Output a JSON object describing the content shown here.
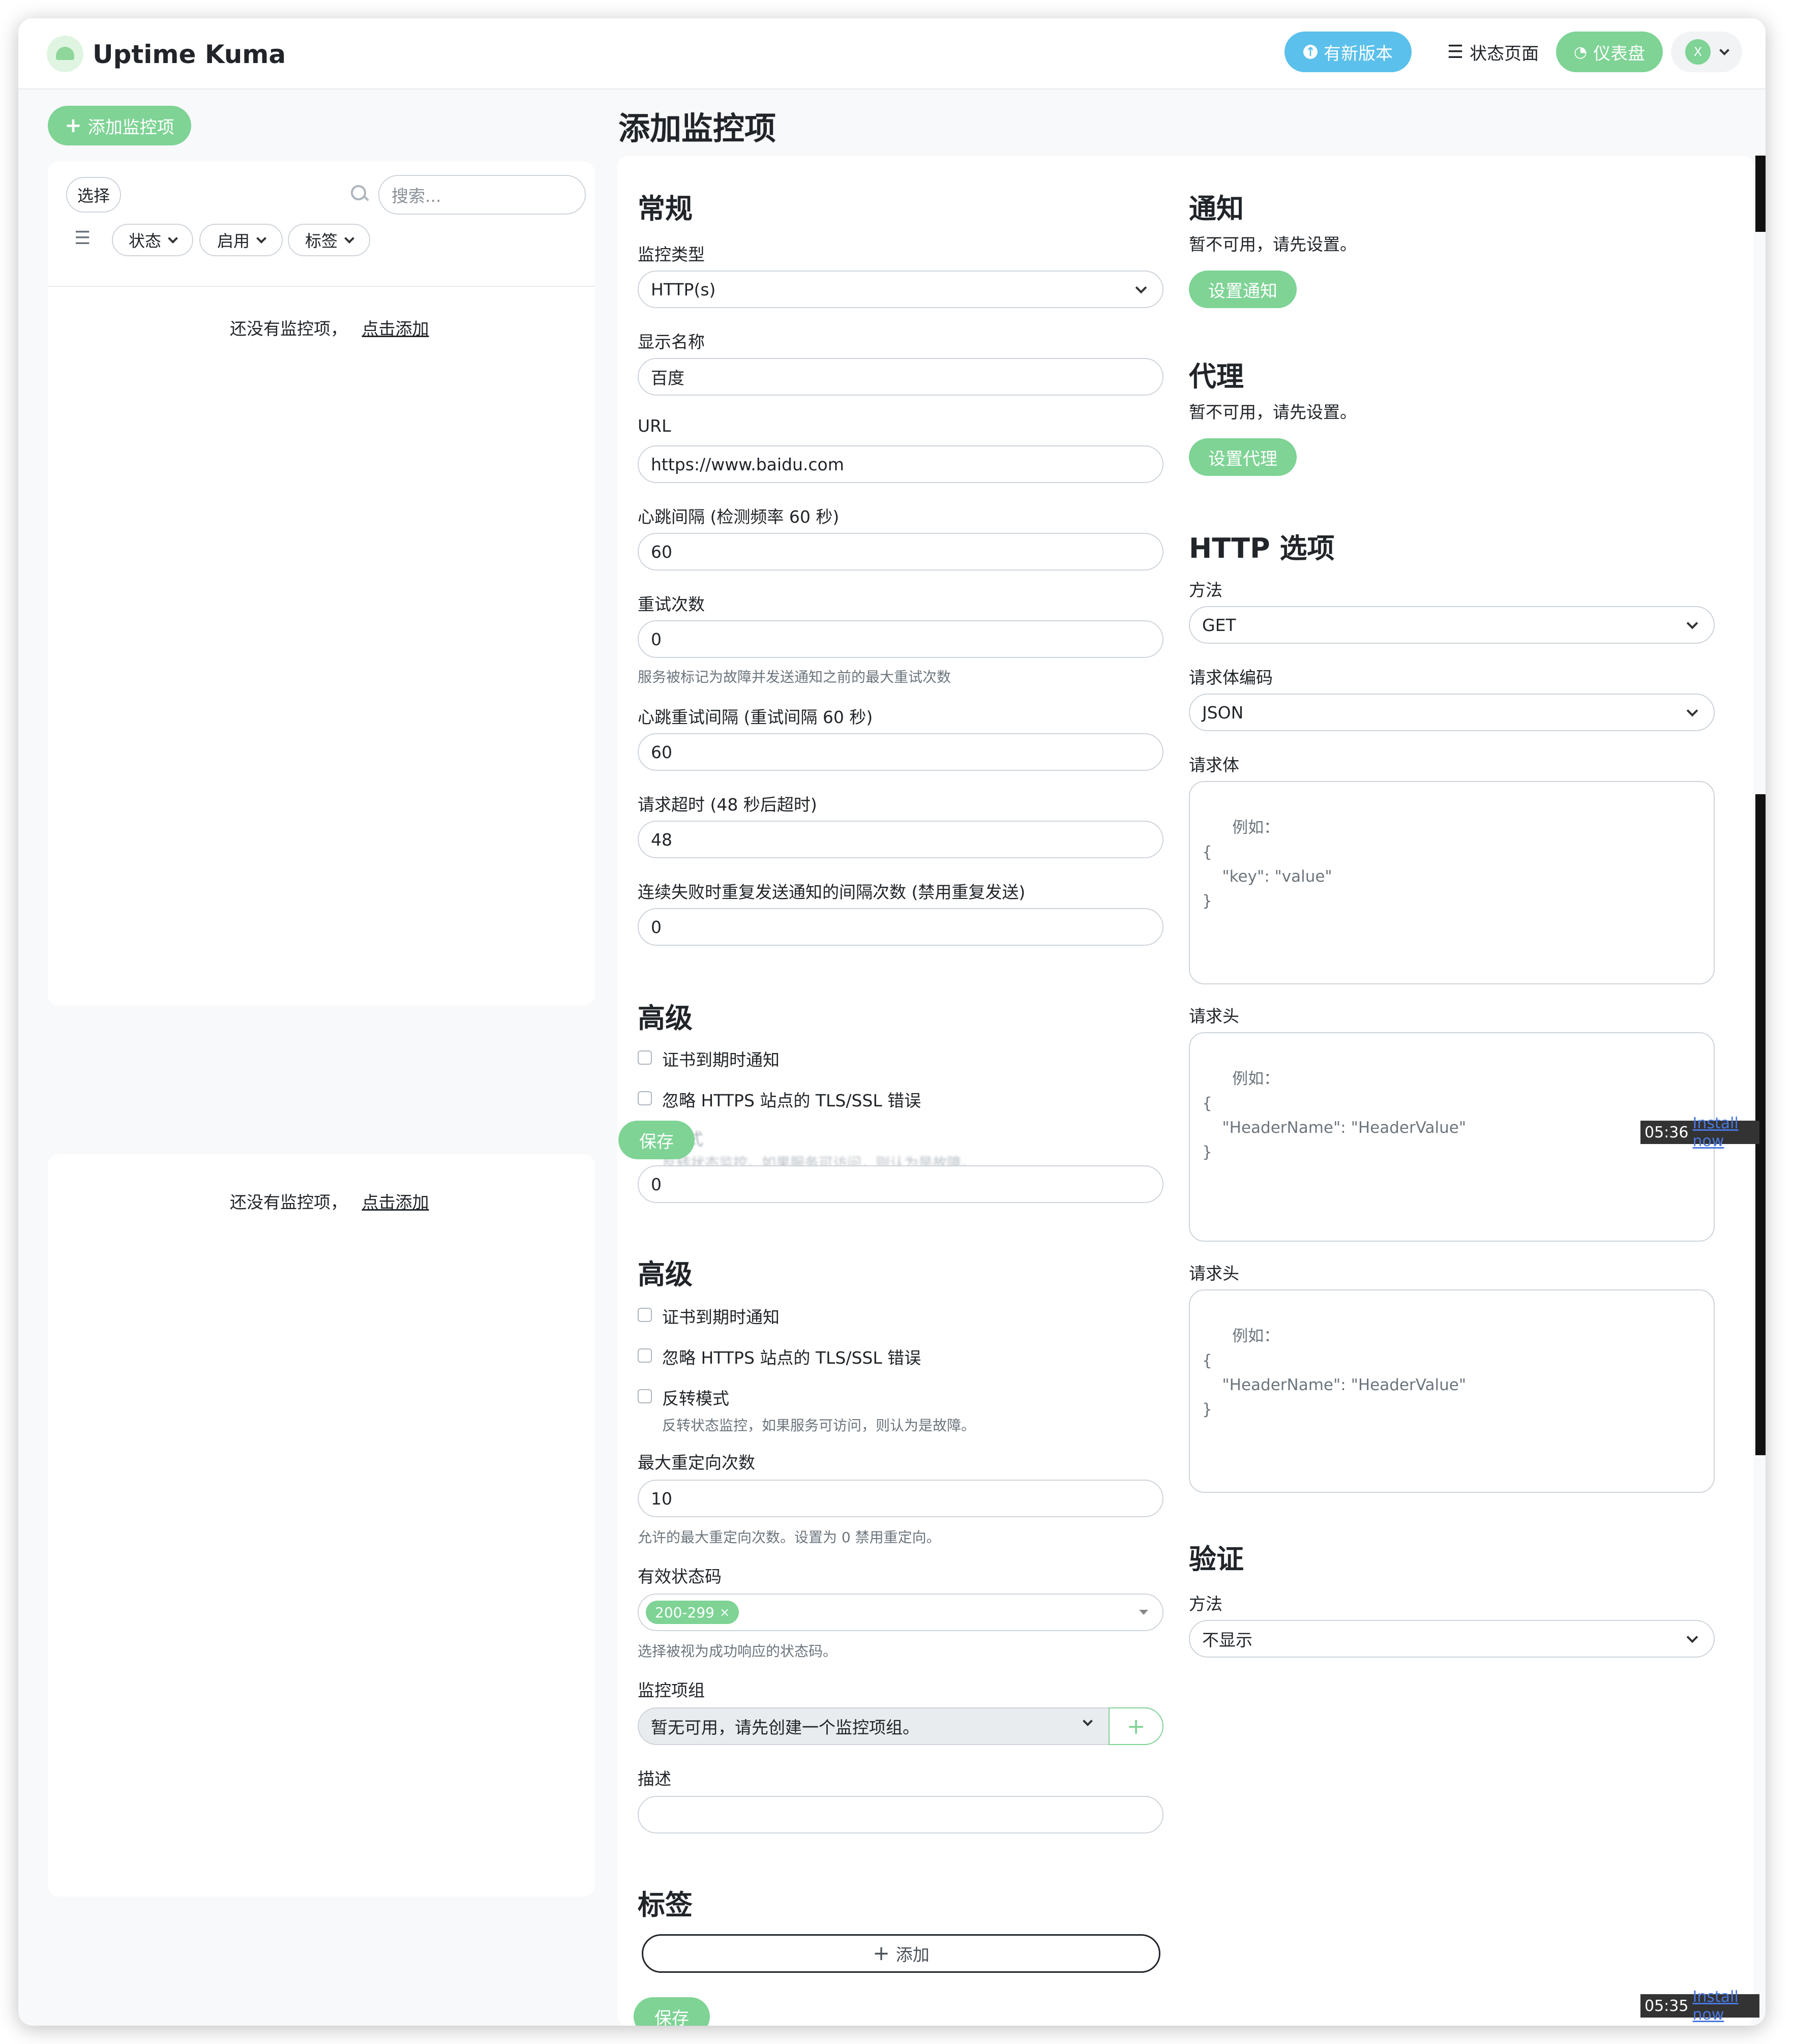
{
  "app": {
    "brand": "Uptime Kuma"
  },
  "header": {
    "update_button": "有新版本",
    "status_page": "状态页面",
    "dashboard": "仪表盘",
    "avatar_letter": "X",
    "accent": "#5cdd8b"
  },
  "sidebar": {
    "add_monitor": "添加监控项",
    "select_label": "选择",
    "search_placeholder": "搜索...",
    "filters": [
      "状态",
      "启用",
      "标签"
    ],
    "empty_text": "还没有监控项，",
    "empty_link": "点击添加"
  },
  "page": {
    "title": "添加监控项"
  },
  "general": {
    "heading": "常规",
    "monitor_type_label": "监控类型",
    "monitor_type_value": "HTTP(s)",
    "friendly_name_label": "显示名称",
    "friendly_name_value": "百度",
    "url_label": "URL",
    "url_value": "https://www.baidu.com",
    "interval_label": "心跳间隔 (检测频率 60 秒)",
    "interval_value": "60",
    "retries_label": "重试次数",
    "retries_value": "0",
    "retries_help": "服务被标记为故障并发送通知之前的最大重试次数",
    "retry_interval_label": "心跳重试间隔 (重试间隔 60 秒)",
    "retry_interval_value": "60",
    "timeout_label": "请求超时 (48 秒后超时)",
    "timeout_value": "48",
    "resend_label": "连续失败时重复发送通知的间隔次数 (禁用重复发送)",
    "resend_value": "0"
  },
  "advanced_overlay": {
    "heading": "高级",
    "cert_expiry": "证书到期时通知",
    "ignore_tls": "忽略 HTTPS 站点的 TLS/SSL 错误",
    "save": "保存",
    "ghost_partial": "式",
    "ghost_help": "反转状态监控。如果服务可访问，则认为是故障。",
    "ghost_value": "0"
  },
  "advanced": {
    "heading": "高级",
    "cert_expiry": "证书到期时通知",
    "ignore_tls": "忽略 HTTPS 站点的 TLS/SSL 错误",
    "upside_down": "反转模式",
    "upside_down_help": "反转状态监控，如果服务可访问，则认为是故障。",
    "max_redirects_label": "最大重定向次数",
    "max_redirects_value": "10",
    "max_redirects_help": "允许的最大重定向次数。设置为 0 禁用重定向。",
    "status_codes_label": "有效状态码",
    "status_code_tag": "200-299",
    "status_codes_help": "选择被视为成功响应的状态码。",
    "group_label": "监控项组",
    "group_value": "暂无可用，请先创建一个监控项组。",
    "description_label": "描述"
  },
  "tags": {
    "heading": "标签",
    "add": "添加"
  },
  "save_button": "保存",
  "notifications": {
    "heading": "通知",
    "unavailable": "暂不可用，请先设置。",
    "setup": "设置通知"
  },
  "proxy": {
    "heading": "代理",
    "unavailable": "暂不可用，请先设置。",
    "setup": "设置代理"
  },
  "http_options": {
    "heading": "HTTP 选项",
    "method_label": "方法",
    "method_value": "GET",
    "body_encoding_label": "请求体编码",
    "body_encoding_value": "JSON",
    "body_label": "请求体",
    "body_placeholder": "例如：\n{\n    \"key\": \"value\"\n}",
    "headers_label": "请求头",
    "headers_placeholder": "例如：\n{\n    \"HeaderName\": \"HeaderValue\"\n}"
  },
  "auth": {
    "heading": "验证",
    "method_label": "方法",
    "method_value": "不显示"
  },
  "toasts": [
    {
      "time": "05:36",
      "link": "Install now"
    },
    {
      "time": "05:35",
      "link": "Install now"
    }
  ]
}
